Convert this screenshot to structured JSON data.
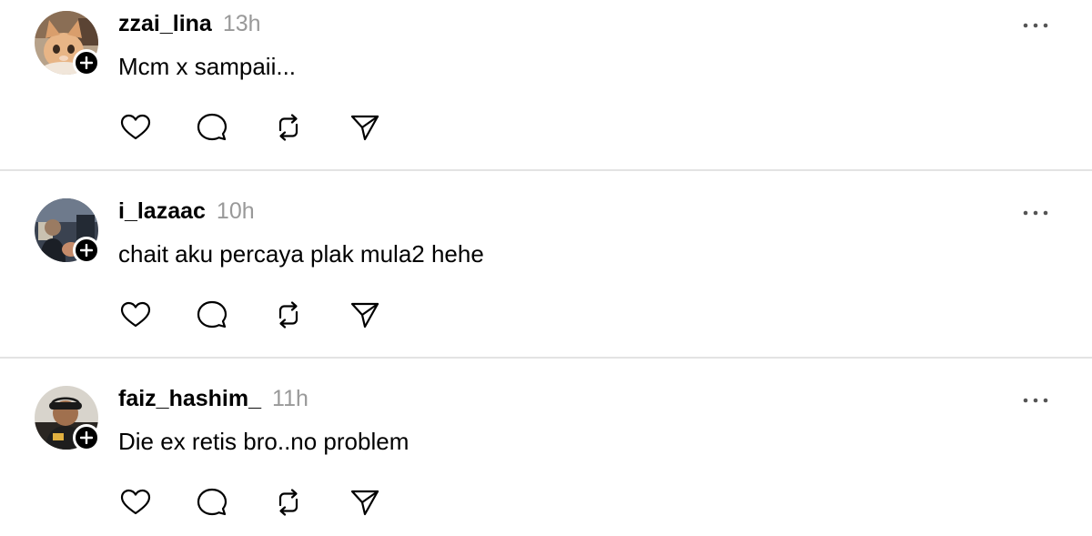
{
  "posts": [
    {
      "username": "zzai_lina",
      "time": "13h",
      "text": "Mcm x sampaii...",
      "avatar_icon": "cat-avatar"
    },
    {
      "username": "i_lazaac",
      "time": "10h",
      "text": "chait aku percaya plak mula2 hehe",
      "avatar_icon": "person-avatar"
    },
    {
      "username": "faiz_hashim_",
      "time": "11h",
      "text": "Die ex retis bro..no problem",
      "avatar_icon": "person-cap-avatar"
    }
  ],
  "icons": {
    "more": "more-icon",
    "like": "heart-icon",
    "comment": "comment-icon",
    "repost": "repost-icon",
    "share": "send-icon",
    "follow": "plus-icon"
  },
  "colors": {
    "text": "#000000",
    "timestamp": "#999999",
    "divider": "#e3e3e3",
    "icon": "#000000"
  }
}
